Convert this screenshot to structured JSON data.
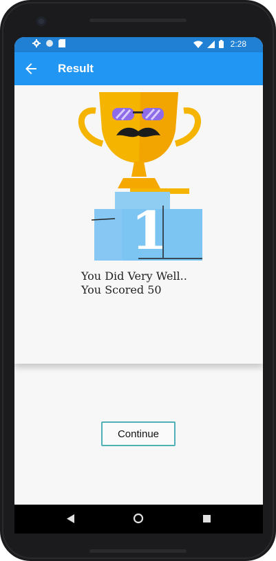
{
  "statusbar": {
    "time": "2:28",
    "left_icons": [
      "settings-icon",
      "circle-icon",
      "sd-card-icon"
    ],
    "right_icons": [
      "wifi-icon",
      "signal-icon",
      "battery-icon"
    ]
  },
  "appbar": {
    "title": "Result",
    "back_icon": "arrow-back-icon"
  },
  "result": {
    "illustration": "trophy-on-podium-first-place",
    "podium_rank": "1",
    "line1": "You Did Very Well..",
    "line2": "You Scored 50"
  },
  "actions": {
    "continue_label": "Continue"
  },
  "navbar": {
    "icons": [
      "nav-back-icon",
      "nav-home-icon",
      "nav-recents-icon"
    ]
  },
  "colors": {
    "statusbar": "#1f80d4",
    "appbar": "#2196f3",
    "button_border": "#4fb1b7",
    "trophy": "#f5b400",
    "podium": "#7cc4f2"
  }
}
